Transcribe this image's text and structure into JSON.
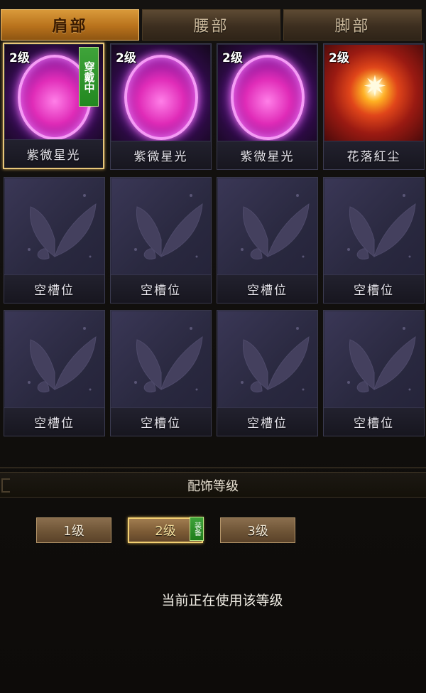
{
  "tabs": [
    {
      "label": "肩部",
      "active": true
    },
    {
      "label": "腰部",
      "active": false
    },
    {
      "label": "脚部",
      "active": false
    }
  ],
  "slots": [
    {
      "level": "2级",
      "name": "紫微星光",
      "art": "purple-orb",
      "wearing": "穿戴中"
    },
    {
      "level": "2级",
      "name": "紫微星光",
      "art": "purple-orb"
    },
    {
      "level": "2级",
      "name": "紫微星光",
      "art": "purple-orb"
    },
    {
      "level": "2级",
      "name": "花落紅尘",
      "art": "flame-burst"
    },
    {
      "name": "空槽位",
      "art": "butterfly"
    },
    {
      "name": "空槽位",
      "art": "butterfly"
    },
    {
      "name": "空槽位",
      "art": "butterfly"
    },
    {
      "name": "空槽位",
      "art": "butterfly"
    },
    {
      "name": "空槽位",
      "art": "butterfly"
    },
    {
      "name": "空槽位",
      "art": "butterfly"
    },
    {
      "name": "空槽位",
      "art": "butterfly"
    },
    {
      "name": "空槽位",
      "art": "butterfly"
    }
  ],
  "section": {
    "title": "配饰等级"
  },
  "levels": [
    {
      "label": "1级",
      "active": false
    },
    {
      "label": "2级",
      "active": true,
      "tag": "装备"
    },
    {
      "label": "3级",
      "active": false
    }
  ],
  "status": {
    "text": "当前正在使用该等级"
  },
  "colors": {
    "tab_active": "#c07a20",
    "badge_green": "#2f9a2b",
    "gold_border": "#e8c77a"
  }
}
